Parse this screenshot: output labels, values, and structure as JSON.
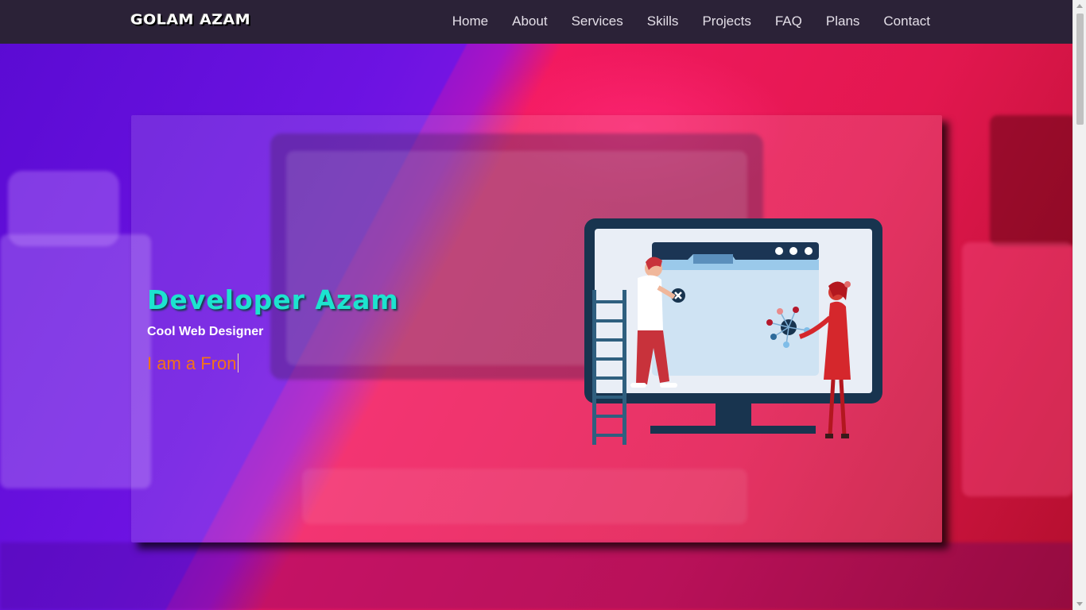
{
  "brand": {
    "logo_text": "GOLAM AZAM"
  },
  "nav": {
    "items": [
      {
        "label": "Home"
      },
      {
        "label": "About"
      },
      {
        "label": "Services"
      },
      {
        "label": "Skills"
      },
      {
        "label": "Projects"
      },
      {
        "label": "FAQ"
      },
      {
        "label": "Plans"
      },
      {
        "label": "Contact"
      }
    ]
  },
  "hero": {
    "title": "Developer Azam",
    "subtitle": "Cool Web Designer",
    "typed_text": "I am a Fron"
  },
  "colors": {
    "nav_bg": "#2b2237",
    "title": "#1de3cf",
    "typed": "#f37318",
    "accent_purple": "#6a12d8",
    "accent_pink": "#f2195f"
  },
  "icons": [
    "screen-illustration-icon",
    "ladder-icon",
    "browser-window-icon"
  ]
}
